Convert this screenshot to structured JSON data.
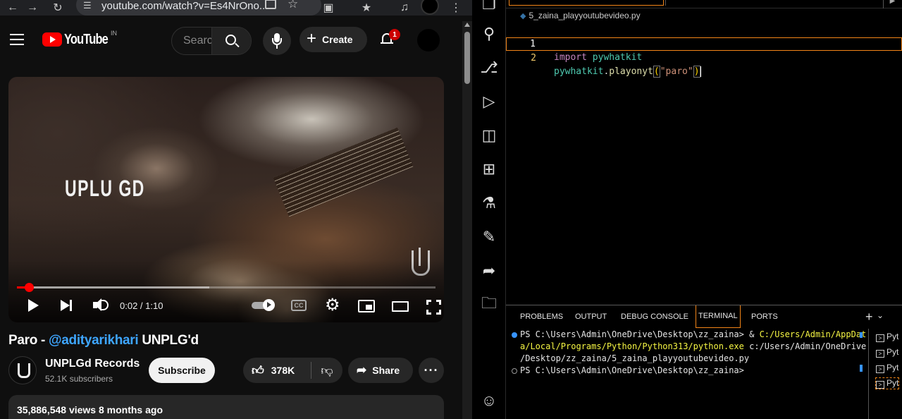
{
  "browser": {
    "url": "youtube.com/watch?v=Es4NrOno...",
    "youtube": {
      "logo_text": "YouTube",
      "country_code": "IN",
      "search_placeholder": "Search",
      "create_label": "Create",
      "notification_count": "1",
      "video": {
        "time_display": "0:02 / 1:10",
        "played_fraction": 0.028,
        "buffered_fraction": 0.46,
        "overlay_text": "UPLU GD",
        "cc_label": "CC"
      },
      "title": {
        "prefix": "Paro - ",
        "mention": "@adityarikhari",
        "suffix": " UNPLG'd"
      },
      "channel": {
        "name": "UNPLGd Records",
        "subscribers": "52.1K subscribers"
      },
      "subscribe_label": "Subscribe",
      "likes": "378K",
      "share_label": "Share",
      "views_line": "35,886,548 views  8 months ago"
    }
  },
  "vscode": {
    "breadcrumb_file": "5_zaina_playyoutubevideo.py",
    "code_lines": [
      {
        "number": "1",
        "kw": "import",
        "module": "pywhatkit"
      },
      {
        "number": "2",
        "obj": "pywhatkit",
        "method": "playonyt",
        "arg": "\"paro\""
      }
    ],
    "panel_tabs": [
      "PROBLEMS",
      "OUTPUT",
      "DEBUG CONSOLE",
      "TERMINAL",
      "PORTS"
    ],
    "active_panel_tab": "TERMINAL",
    "terminal": {
      "line1_prompt": "PS C:\\Users\\Admin\\OneDrive\\Desktop\\zz_zaina> & ",
      "line1_path": "C:/Users/Admin/AppDat",
      "line2_path": "a/Local/Programs/Python/Python313/python.exe",
      "line2_rest": " c:/Users/Admin/OneDrive",
      "line3": "/Desktop/zz_zaina/5_zaina_playyoutubevideo.py",
      "line4": "PS C:\\Users\\Admin\\OneDrive\\Desktop\\zz_zaina> "
    },
    "terminal_list": [
      "Pyt",
      "Pyt",
      "Pyt",
      "Pyt"
    ]
  },
  "colors": {
    "youtube_red": "#ff0000",
    "mention_blue": "#3ea6ff",
    "focus_orange": "#f38518",
    "terminal_yellow": "#f5f543"
  }
}
